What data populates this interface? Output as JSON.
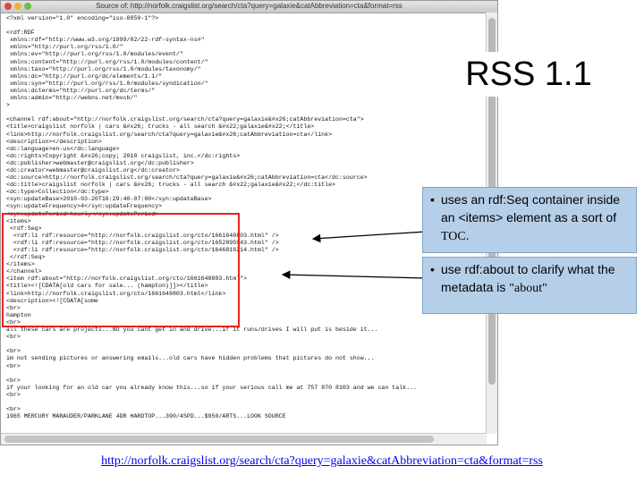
{
  "window": {
    "title": "Source of: http://norfolk.craigslist.org/search/cta?query=galaxie&catAbbreviation=cta&format=rss"
  },
  "source_lines": [
    "<?xml version=\"1.0\" encoding=\"iso-8859-1\"?>",
    "",
    "<rdf:RDF",
    " xmlns:rdf=\"http://www.w3.org/1999/02/22-rdf-syntax-ns#\"",
    " xmlns=\"http://purl.org/rss/1.0/\"",
    " xmlns:ev=\"http://purl.org/rss/1.0/modules/event/\"",
    " xmlns:content=\"http://purl.org/rss/1.0/modules/content/\"",
    " xmlns:taxo=\"http://purl.org/rss/1.0/modules/taxonomy/\"",
    " xmlns:dc=\"http://purl.org/dc/elements/1.1/\"",
    " xmlns:syn=\"http://purl.org/rss/1.0/modules/syndication/\"",
    " xmlns:dcterms=\"http://purl.org/dc/terms/\"",
    " xmlns:admin=\"http://webns.net/mvcb/\"",
    ">",
    "",
    "<channel rdf:about=\"http://norfolk.craigslist.org/search/cta?query=galaxie&#x26;catAbbreviation=cta\">",
    "<title>craigslist norfolk | cars &#x26; trucks - all search &#x22;galaxie&#x22;</title>",
    "<link>http://norfolk.craigslist.org/search/cta?query=galaxie&#x26;catAbbreviation=cta</link>",
    "<description></description>",
    "<dc:language>en-us</dc:language>",
    "<dc:rights>Copyright &#x26;copy; 2010 craigslist, inc.</dc:rights>",
    "<dc:publisher>webmaster@craigslist.org</dc:publisher>",
    "<dc:creator>webmaster@craigslist.org</dc:creator>",
    "<dc:source>http://norfolk.craigslist.org/search/cta?query=galaxie&#x26;catAbbreviation=cta</dc:source>",
    "<dc:title>craigslist norfolk | cars &#x26; trucks - all search &#x22;galaxie&#x22;</dc:title>",
    "<dc:type>Collection</dc:type>",
    "<syn:updateBase>2010-03-20T16:29:40-07:00</syn:updateBase>",
    "<syn:updateFrequency>4</syn:updateFrequency>",
    "<syn:updatePeriod>hourly</syn:updatePeriod>",
    "<items>",
    " <rdf:Seq>",
    "  <rdf:li rdf:resource=\"http://norfolk.craigslist.org/cto/1661648803.html\" />",
    "  <rdf:li rdf:resource=\"http://norfolk.craigslist.org/cto/1652895943.html\" />",
    "  <rdf:li rdf:resource=\"http://norfolk.craigslist.org/cto/1646816214.html\" />",
    " </rdf:Seq>",
    "</items>",
    "</channel>",
    "<item rdf:about=\"http://norfolk.craigslist.org/cto/1661648803.html\">",
    "<title><![CDATA[old cars for sale... (hampton)]]></title>",
    "<link>http://norfolk.craigslist.org/cto/1661648803.html</link>",
    "<description><![CDATA[some",
    "<br>",
    "hampton",
    "<br>",
    "all these cars are projects...NO you cant get in and drive...if it runs/drives I will put is beside it...",
    "<br>",
    "",
    "<br>",
    "im not sending pictures or answering emails...old cars have hidden problems that pictures do not show...",
    "<br>",
    "",
    "<br>",
    "if your looking for an old car you already know this...so if your serious call me at 757 870 8103 and we can talk...",
    "<br>",
    "",
    "<br>",
    "1965 MERCURY MARAUDER/PARKLANE 4DR HARDTOP...390/4SPD...$950/ARTS...LOOK SOURCE"
  ],
  "slide": {
    "title": "RSS 1.1",
    "bullets": [
      {
        "marker": "•",
        "text_html": "uses an rdf:Seq container inside an <items> element as a sort of <span style=\"font-family:'Liberation Serif', serif;\">TOC</span>."
      },
      {
        "marker": "•",
        "text_html": "use rdf:about to clarify what the metadata is <span style=\"font-family:'Liberation Serif', serif;\">\"about\"</span>"
      }
    ],
    "url": "http://norfolk.craigslist.org/search/cta?query=galaxie&catAbbreviation=cta&format=rss"
  },
  "colors": {
    "box_fill": "#b6cfe9",
    "highlight_border": "#e8231b",
    "link": "#0000ee"
  }
}
